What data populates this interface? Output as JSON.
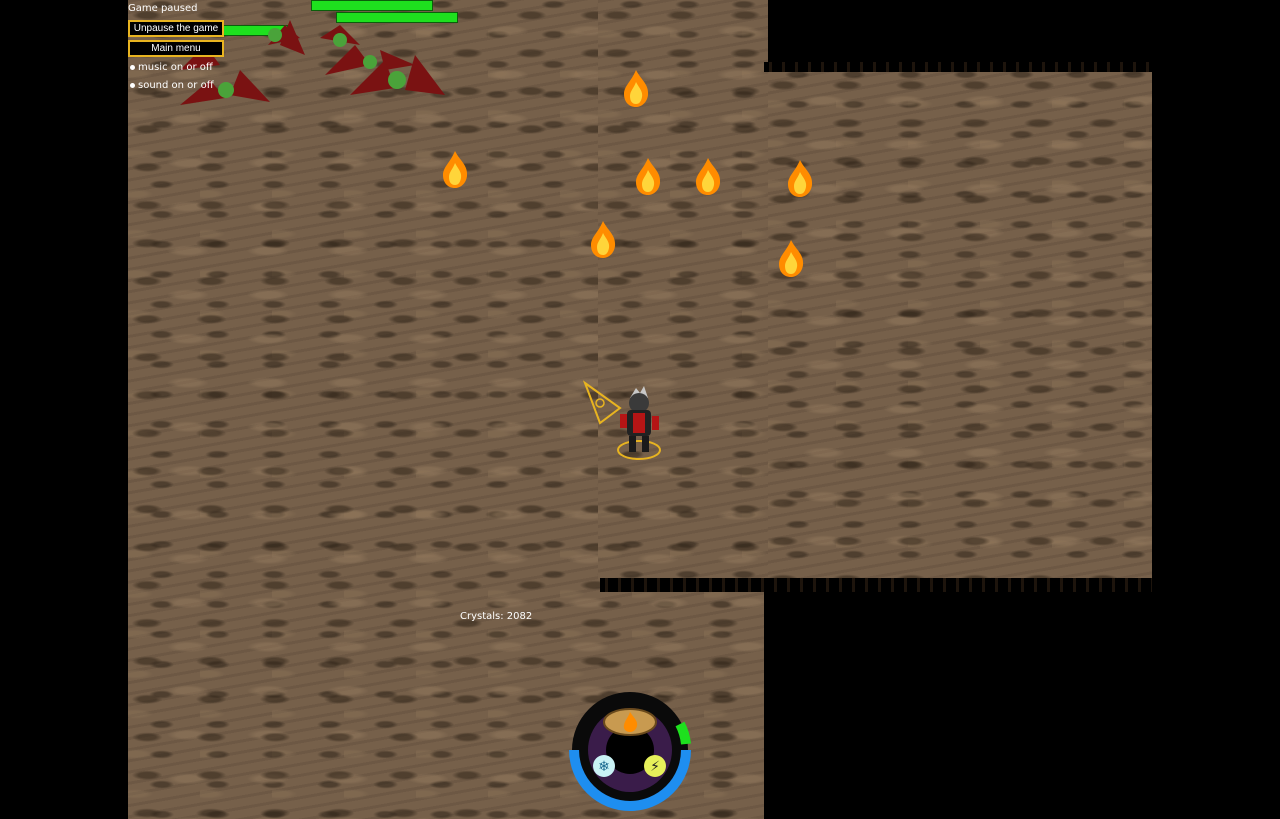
{
  "hud": {
    "status": "Game paused",
    "unpause_label": "Unpause the game",
    "main_menu_label": "Main menu",
    "music_toggle": "music on or off",
    "sound_toggle": "sound on or off",
    "crystals": "Crystals: 2082"
  },
  "icons": {
    "fire_spell": "fire-icon",
    "ice_spell": "snowflake-icon",
    "lightning_spell": "lightning-icon"
  },
  "colors": {
    "button_border": "#e8b420",
    "health": "#1ee01e",
    "mana": "#1e8ef0",
    "floor": "#76604a"
  },
  "player": {
    "mana_fraction": 0.5,
    "stamina_fraction": 0.1
  }
}
